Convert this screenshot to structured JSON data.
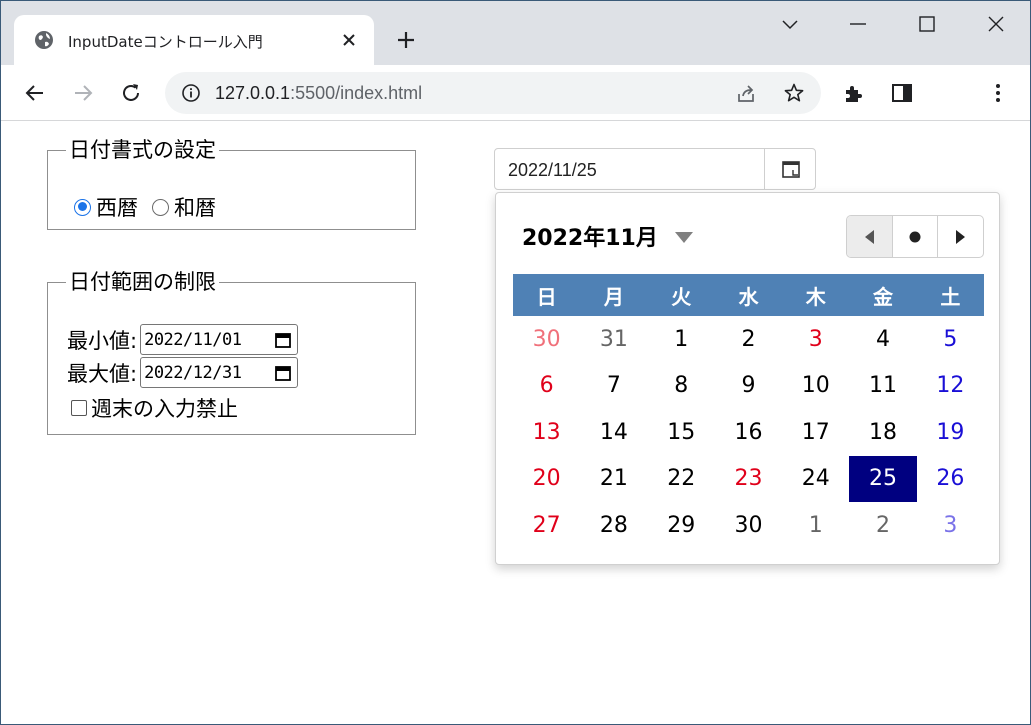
{
  "browser": {
    "tab_title": "InputDateコントロール入門",
    "url_host": "127.0.0.1",
    "url_rest": ":5500/index.html"
  },
  "format_group": {
    "legend": "日付書式の設定",
    "options": [
      {
        "label": "西暦",
        "checked": true
      },
      {
        "label": "和暦",
        "checked": false
      }
    ]
  },
  "range_group": {
    "legend": "日付範囲の制限",
    "min_label": "最小値:",
    "min_value": "2022/11/01",
    "max_label": "最大値:",
    "max_value": "2022/12/31",
    "weekend_label": "週末の入力禁止"
  },
  "picker": {
    "value": "2022/11/25",
    "month_title": "2022年11月",
    "weekdays": [
      "日",
      "月",
      "火",
      "水",
      "木",
      "金",
      "土"
    ],
    "weeks": [
      [
        {
          "d": "30",
          "t": "other sun"
        },
        {
          "d": "31",
          "t": "other"
        },
        {
          "d": "1",
          "t": ""
        },
        {
          "d": "2",
          "t": ""
        },
        {
          "d": "3",
          "t": "hol"
        },
        {
          "d": "4",
          "t": ""
        },
        {
          "d": "5",
          "t": "sat"
        }
      ],
      [
        {
          "d": "6",
          "t": "sun"
        },
        {
          "d": "7",
          "t": ""
        },
        {
          "d": "8",
          "t": ""
        },
        {
          "d": "9",
          "t": ""
        },
        {
          "d": "10",
          "t": ""
        },
        {
          "d": "11",
          "t": ""
        },
        {
          "d": "12",
          "t": "sat"
        }
      ],
      [
        {
          "d": "13",
          "t": "sun"
        },
        {
          "d": "14",
          "t": ""
        },
        {
          "d": "15",
          "t": ""
        },
        {
          "d": "16",
          "t": ""
        },
        {
          "d": "17",
          "t": ""
        },
        {
          "d": "18",
          "t": ""
        },
        {
          "d": "19",
          "t": "sat"
        }
      ],
      [
        {
          "d": "20",
          "t": "sun"
        },
        {
          "d": "21",
          "t": ""
        },
        {
          "d": "22",
          "t": ""
        },
        {
          "d": "23",
          "t": "hol"
        },
        {
          "d": "24",
          "t": ""
        },
        {
          "d": "25",
          "t": "sel"
        },
        {
          "d": "26",
          "t": "sat"
        }
      ],
      [
        {
          "d": "27",
          "t": "sun"
        },
        {
          "d": "28",
          "t": ""
        },
        {
          "d": "29",
          "t": ""
        },
        {
          "d": "30",
          "t": ""
        },
        {
          "d": "1",
          "t": "other"
        },
        {
          "d": "2",
          "t": "other"
        },
        {
          "d": "3",
          "t": "other sat"
        }
      ]
    ]
  },
  "colors": {
    "header_bg": "#4f81b5",
    "selected_bg": "#000080",
    "sunday": "#e0001a",
    "saturday": "#1a0fd6"
  }
}
